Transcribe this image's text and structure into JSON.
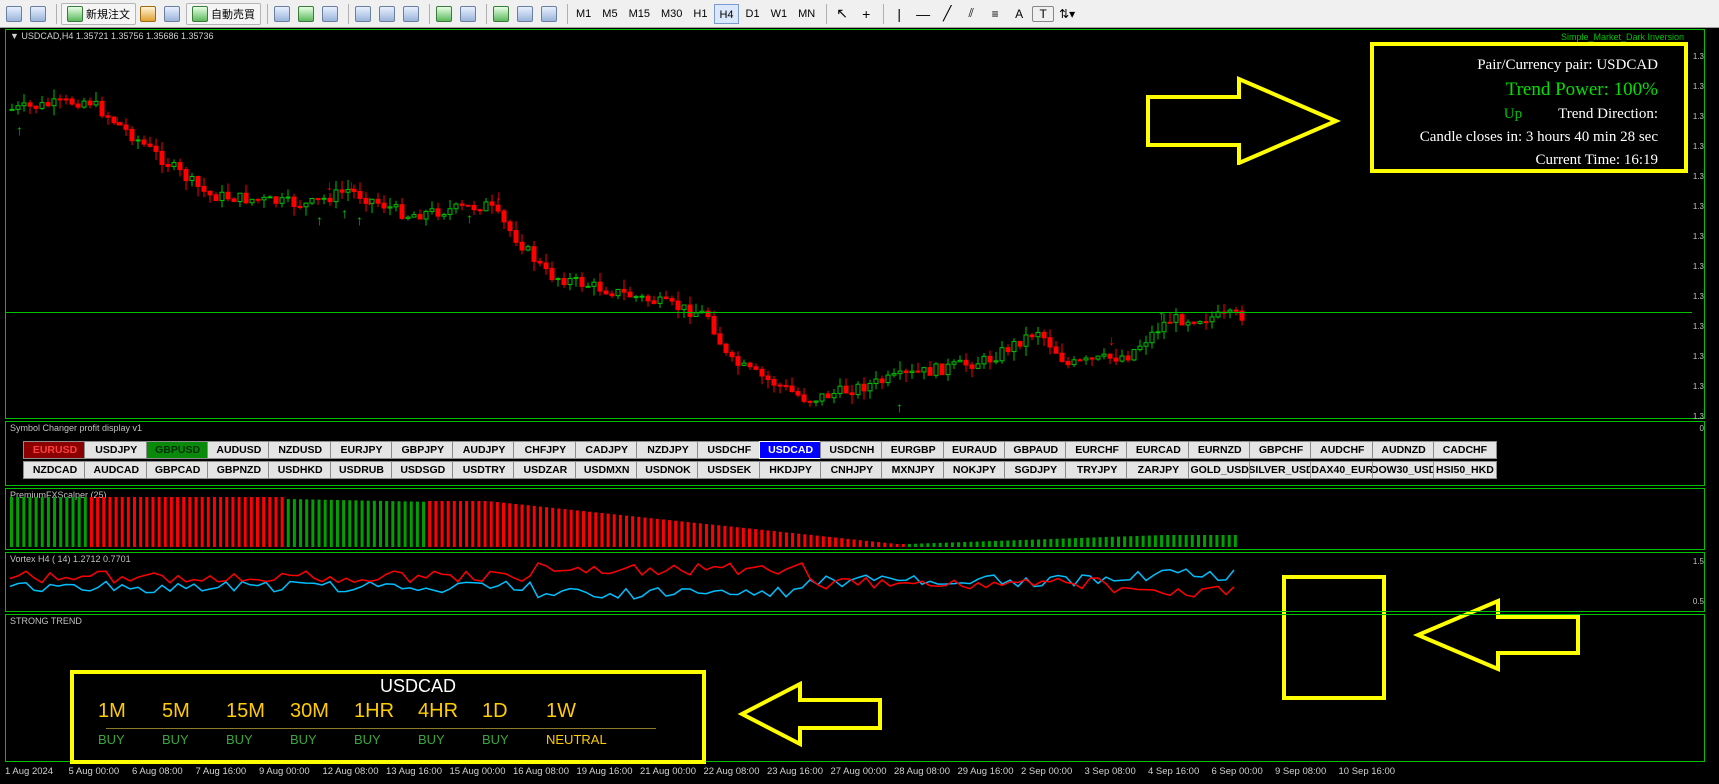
{
  "toolbar": {
    "new_order_label": "新規注文",
    "auto_trade_label": "自動売買",
    "timeframes": [
      "M1",
      "M5",
      "M15",
      "M30",
      "H1",
      "H4",
      "D1",
      "W1",
      "MN"
    ],
    "active_timeframe": "H4"
  },
  "chart": {
    "title": "USDCAD,H4  1.35721 1.35756 1.35686 1.35736",
    "indicator_name": "Simple_Market_Dark Inversion",
    "bull_color": "#00c000",
    "bear_color": "#ff0000"
  },
  "info_panel": {
    "pair_line": "Pair/Currency pair: USDCAD",
    "trend_power": "Trend Power: 100%",
    "direction_value": "Up",
    "direction_label": "Trend Direction:",
    "candle_close": "Candle closes in: 3 hours 40 min 28 sec",
    "current_time": "Current Time: 16:19"
  },
  "symbol_panel": {
    "title": "Symbol Changer profit display  v1",
    "row1": [
      "EURUSD",
      "USDJPY",
      "GBPUSD",
      "AUDUSD",
      "NZDUSD",
      "EURJPY",
      "GBPJPY",
      "AUDJPY",
      "CHFJPY",
      "CADJPY",
      "NZDJPY",
      "USDCHF",
      "USDCAD",
      "USDCNH",
      "EURGBP",
      "EURAUD",
      "GBPAUD",
      "EURCHF",
      "EURCAD",
      "EURNZD",
      "GBPCHF",
      "AUDCHF",
      "AUDNZD",
      "CADCHF"
    ],
    "row2": [
      "NZDCAD",
      "AUDCAD",
      "GBPCAD",
      "GBPNZD",
      "USDHKD",
      "USDRUB",
      "USDSGD",
      "USDTRY",
      "USDZAR",
      "USDMXN",
      "USDNOK",
      "USDSEK",
      "HKDJPY",
      "CNHJPY",
      "MXNJPY",
      "NOKJPY",
      "SGDJPY",
      "TRYJPY",
      "ZARJPY",
      "GOLD_USD",
      "SILVER_USD",
      "DAX40_EUR",
      "DOW30_USD",
      "HSI50_HKD"
    ],
    "selected": "USDCAD",
    "green_symbol": "GBPUSD",
    "red_symbol": "EURUSD"
  },
  "scalper_panel": {
    "title": "PremiumFXScalper (25)"
  },
  "vortex_panel": {
    "title": "Vortex H4 ( 14) 1.2712 0.7701",
    "plus_color": "#00bfff",
    "minus_color": "#ff0000",
    "scale_top": "1.5",
    "scale_bottom": "0.5"
  },
  "strong_trend": {
    "title": "STRONG TREND",
    "symbol": "USDCAD",
    "timeframes": [
      {
        "tf": "1M",
        "signal": "BUY"
      },
      {
        "tf": "5M",
        "signal": "BUY"
      },
      {
        "tf": "15M",
        "signal": "BUY"
      },
      {
        "tf": "30M",
        "signal": "BUY"
      },
      {
        "tf": "1HR",
        "signal": "BUY"
      },
      {
        "tf": "4HR",
        "signal": "BUY"
      },
      {
        "tf": "1D",
        "signal": "BUY"
      },
      {
        "tf": "1W",
        "signal": "NEUTRAL"
      }
    ]
  },
  "time_axis": [
    "1 Aug 2024",
    "5 Aug 00:00",
    "6 Aug 08:00",
    "7 Aug 16:00",
    "9 Aug 00:00",
    "12 Aug 08:00",
    "13 Aug 16:00",
    "15 Aug 00:00",
    "16 Aug 08:00",
    "19 Aug 16:00",
    "21 Aug 00:00",
    "22 Aug 08:00",
    "23 Aug 16:00",
    "27 Aug 00:00",
    "28 Aug 08:00",
    "29 Aug 16:00",
    "2 Sep 00:00",
    "3 Sep 08:00",
    "4 Sep 16:00",
    "6 Sep 00:00",
    "9 Sep 08:00",
    "10 Sep 16:00"
  ],
  "price_scale": [
    "1.3",
    "1.3",
    "1.3",
    "1.3",
    "1.3",
    "1.3",
    "1.3",
    "1.3",
    "1.3",
    "1.3",
    "1.3",
    "1.3",
    "1.3"
  ]
}
